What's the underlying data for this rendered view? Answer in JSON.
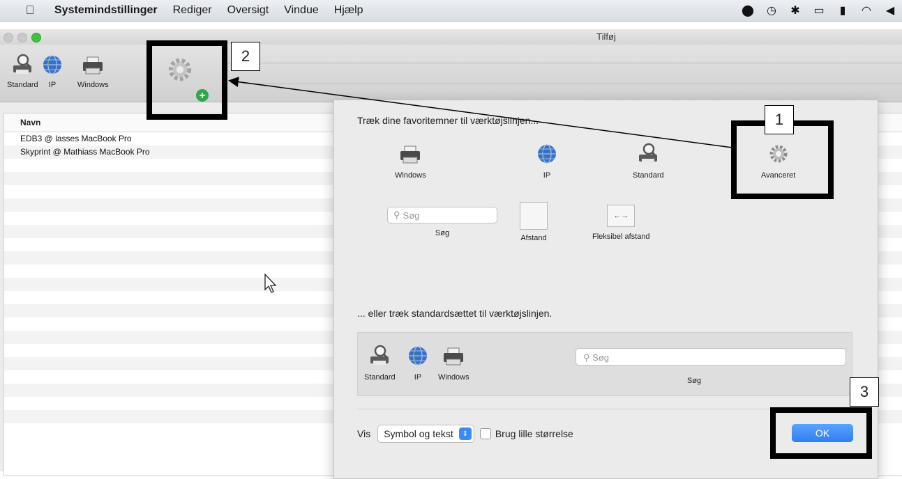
{
  "menubar": {
    "apple_icon": "apple-logo-icon",
    "items": [
      "Systemindstillinger",
      "Rediger",
      "Oversigt",
      "Vindue",
      "Hjælp"
    ],
    "status_icons": [
      "record-icon",
      "time-machine-icon",
      "bluetooth-icon",
      "airplay-icon",
      "battery-icon",
      "wifi-icon",
      "volume-icon"
    ]
  },
  "window": {
    "title": "Tilføj",
    "toolbar": {
      "items": [
        {
          "label": "Standard",
          "icon": "printer-magnifier-icon"
        },
        {
          "label": "IP",
          "icon": "globe-icon"
        },
        {
          "label": "Windows",
          "icon": "windows-printer-icon"
        }
      ],
      "dragged_item_icon": "gear-icon",
      "add_badge_icon": "plus-badge-icon"
    },
    "list": {
      "column_header": "Navn",
      "rows": [
        "EDB3 @ lasses MacBook Pro",
        "Skyprint @ Mathiass MacBook Pro"
      ]
    }
  },
  "customize": {
    "drag_favorites_hint": "Træk dine favoritemner til værktøjslinjen...",
    "palette": [
      {
        "label": "Windows",
        "icon": "windows-printer-icon"
      },
      {
        "label": "IP",
        "icon": "globe-icon"
      },
      {
        "label": "Standard",
        "icon": "printer-magnifier-icon"
      },
      {
        "label": "Avanceret",
        "icon": "gear-icon"
      }
    ],
    "search_placeholder": "Søg",
    "search_label": "Søg",
    "space_label": "Afstand",
    "flexible_space_label": "Fleksibel afstand",
    "drag_default_hint": "... eller træk standardsættet til værktøjslinjen.",
    "default_set": {
      "items": [
        {
          "label": "Standard",
          "icon": "printer-magnifier-icon"
        },
        {
          "label": "IP",
          "icon": "globe-icon"
        },
        {
          "label": "Windows",
          "icon": "windows-printer-icon"
        }
      ],
      "search_placeholder": "Søg",
      "search_label": "Søg"
    },
    "show_label": "Vis",
    "show_select_value": "Symbol og tekst",
    "small_size_label": "Brug lille størrelse",
    "small_size_checked": false,
    "ok_label": "OK"
  },
  "annotations": {
    "labels": [
      "1",
      "2",
      "3"
    ],
    "color": "#000000"
  }
}
